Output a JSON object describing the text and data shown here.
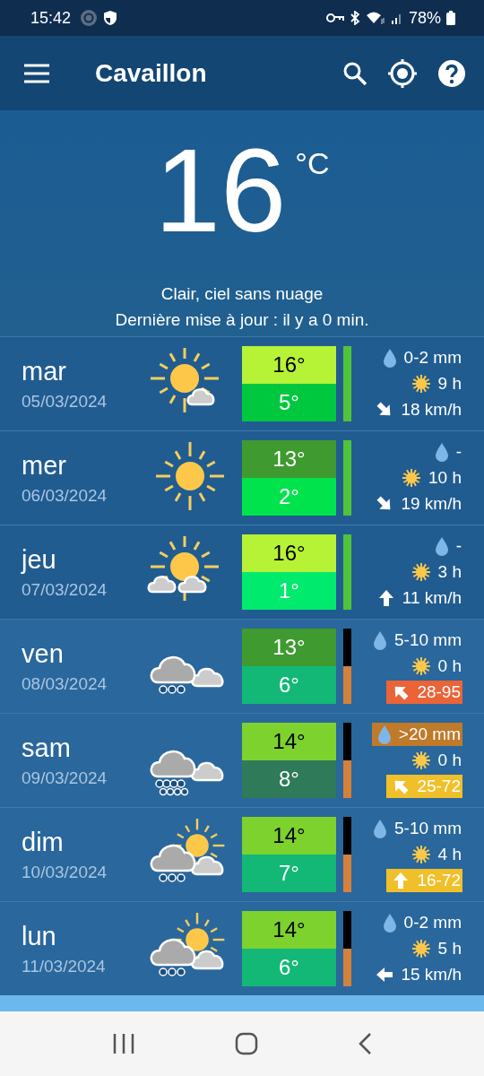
{
  "status_bar": {
    "time": "15:42",
    "battery": "78%"
  },
  "app_bar": {
    "title": "Cavaillon"
  },
  "current": {
    "temperature": "16",
    "unit": "°C",
    "condition": "Clair, ciel sans nuage",
    "updated": "Dernière mise à jour : il y a 0 min."
  },
  "days": [
    {
      "name": "mar",
      "date": "05/03/2024",
      "kind": "suncloud",
      "high": {
        "text": "16°",
        "color": "#b6f236"
      },
      "low": {
        "text": "5°",
        "color": "#00c83e"
      },
      "bar": [
        {
          "color": "#4fc43a"
        },
        {
          "color": "#4fc43a"
        }
      ],
      "rain": {
        "text": "0-2 mm"
      },
      "sun": {
        "text": "9 h"
      },
      "wind": {
        "text": "18 km/h",
        "kind": "se"
      }
    },
    {
      "name": "mer",
      "date": "06/03/2024",
      "kind": "sun",
      "high": {
        "text": "13°",
        "color": "#3f9a30"
      },
      "low": {
        "text": "2°",
        "color": "#00e34d"
      },
      "bar": [
        {
          "color": "#4fc43a"
        },
        {
          "color": "#4fc43a"
        }
      ],
      "rain": {
        "text": "-"
      },
      "sun": {
        "text": "10 h"
      },
      "wind": {
        "text": "19 km/h",
        "kind": "se"
      }
    },
    {
      "name": "jeu",
      "date": "07/03/2024",
      "kind": "sunclouds",
      "high": {
        "text": "16°",
        "color": "#b6f236"
      },
      "low": {
        "text": "1°",
        "color": "#00ea6e"
      },
      "bar": [
        {
          "color": "#4fc43a"
        },
        {
          "color": "#4fc43a"
        }
      ],
      "rain": {
        "text": "-"
      },
      "sun": {
        "text": "3 h"
      },
      "wind": {
        "text": "11 km/h",
        "kind": "n"
      }
    },
    {
      "name": "ven",
      "date": "08/03/2024",
      "kind": "rain",
      "high": {
        "text": "13°",
        "color": "#3f9a30"
      },
      "low": {
        "text": "6°",
        "color": "#13b877"
      },
      "bar": [
        {
          "color": "#000000"
        },
        {
          "color": "#d4813b"
        }
      ],
      "rain": {
        "text": "5-10 mm"
      },
      "sun": {
        "text": "0 h"
      },
      "wind": {
        "text": "28-95",
        "kind": "nw",
        "color": "#ea6437"
      }
    },
    {
      "name": "sam",
      "date": "09/03/2024",
      "kind": "heavyrain",
      "high": {
        "text": "14°",
        "color": "#7dd22e"
      },
      "low": {
        "text": "8°",
        "color": "#2e7a59"
      },
      "bar": [
        {
          "color": "#000000"
        },
        {
          "color": "#d4813b"
        }
      ],
      "rain": {
        "text": ">20 mm",
        "color": "#bf7a2a"
      },
      "sun": {
        "text": "0 h"
      },
      "wind": {
        "text": "25-72",
        "kind": "nw",
        "color": "#f0c02a"
      }
    },
    {
      "name": "dim",
      "date": "10/03/2024",
      "kind": "sunrain",
      "high": {
        "text": "14°",
        "color": "#7dd22e"
      },
      "low": {
        "text": "7°",
        "color": "#13b877"
      },
      "bar": [
        {
          "color": "#000000"
        },
        {
          "color": "#d4813b"
        }
      ],
      "rain": {
        "text": "5-10 mm"
      },
      "sun": {
        "text": "4 h"
      },
      "wind": {
        "text": "16-72",
        "kind": "n",
        "color": "#f0c02a"
      }
    },
    {
      "name": "lun",
      "date": "11/03/2024",
      "kind": "sunrain",
      "high": {
        "text": "14°",
        "color": "#7dd22e"
      },
      "low": {
        "text": "6°",
        "color": "#13b877"
      },
      "bar": [
        {
          "color": "#000000"
        },
        {
          "color": "#d4813b"
        }
      ],
      "rain": {
        "text": "0-2 mm"
      },
      "sun": {
        "text": "5 h"
      },
      "wind": {
        "text": "15 km/h",
        "kind": "w"
      }
    }
  ]
}
